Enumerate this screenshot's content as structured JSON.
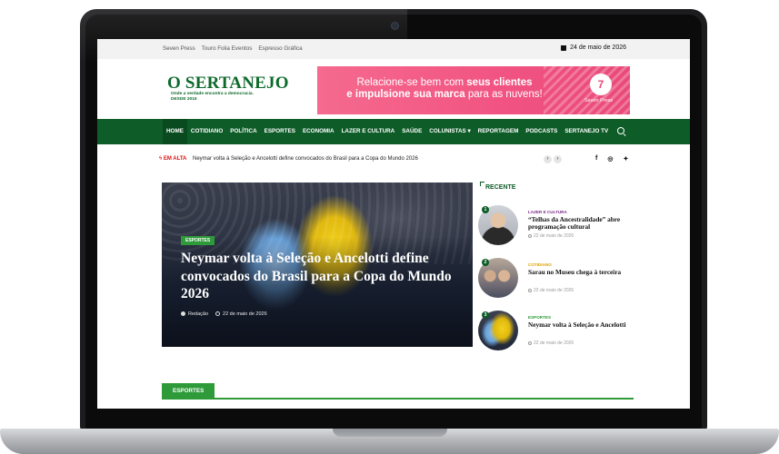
{
  "topbar": {
    "links": [
      "Seven Press",
      "Touro Folia Eventos",
      "Espresso Gráfica"
    ],
    "date": "24 de maio de 2026"
  },
  "logo": {
    "name": "O SERTANEJO",
    "tagline": "Onde a verdade encontra a democracia.",
    "since": "DESDE 2015"
  },
  "ad": {
    "line1_plain": "Relacione-se bem com ",
    "line1_bold": "seus clientes",
    "line2_bold": "e impulsione sua marca",
    "line2_plain": " para as nuvens!",
    "brand": "Seven Press",
    "mark": "7"
  },
  "nav": {
    "items": [
      "HOME",
      "COTIDIANO",
      "POLÍTICA",
      "ESPORTES",
      "ECONOMIA",
      "LAZER E CULTURA",
      "SAÚDE",
      "COLUNISTAS ▾",
      "REPORTAGEM",
      "PODCASTS",
      "SERTANEJO TV"
    ],
    "active_index": 0
  },
  "ticker": {
    "label": "EM ALTA",
    "text": "Neymar volta à Seleção e Ancelotti define convocados do Brasil para a Copa do Mundo 2026",
    "prev": "‹",
    "next": "›",
    "social": [
      "f",
      "◎",
      "✦"
    ]
  },
  "hero": {
    "category": "ESPORTES",
    "title": "Neymar volta à Seleção e Ancelotti define convocados do Brasil para a Copa do Mundo 2026",
    "author": "Redação",
    "date": "22 de maio de 2026"
  },
  "sidebar": {
    "heading": "RECENTE",
    "posts": [
      {
        "num": "1",
        "category": "LAZER E CULTURA",
        "title": "“Telhas da Ancestralidade” abre programação cultural",
        "date": "22 de maio de 2026",
        "cat_color": "#7a2b86"
      },
      {
        "num": "2",
        "category": "COTIDIANO",
        "title": "Sarau no Museu chega à terceira",
        "date": "22 de maio de 2026",
        "cat_color": "#e0a000"
      },
      {
        "num": "3",
        "category": "ESPORTES",
        "title": "Neymar volta à Seleção e Ancelotti",
        "date": "22 de maio de 2026",
        "cat_color": "#2e9a3a"
      }
    ]
  },
  "section": {
    "title": "ESPORTES"
  },
  "colors": {
    "brand_green": "#0e5c28",
    "accent_green": "#2e9a3a",
    "ad_pink": "#f25583",
    "alert_red": "#dd1111"
  }
}
